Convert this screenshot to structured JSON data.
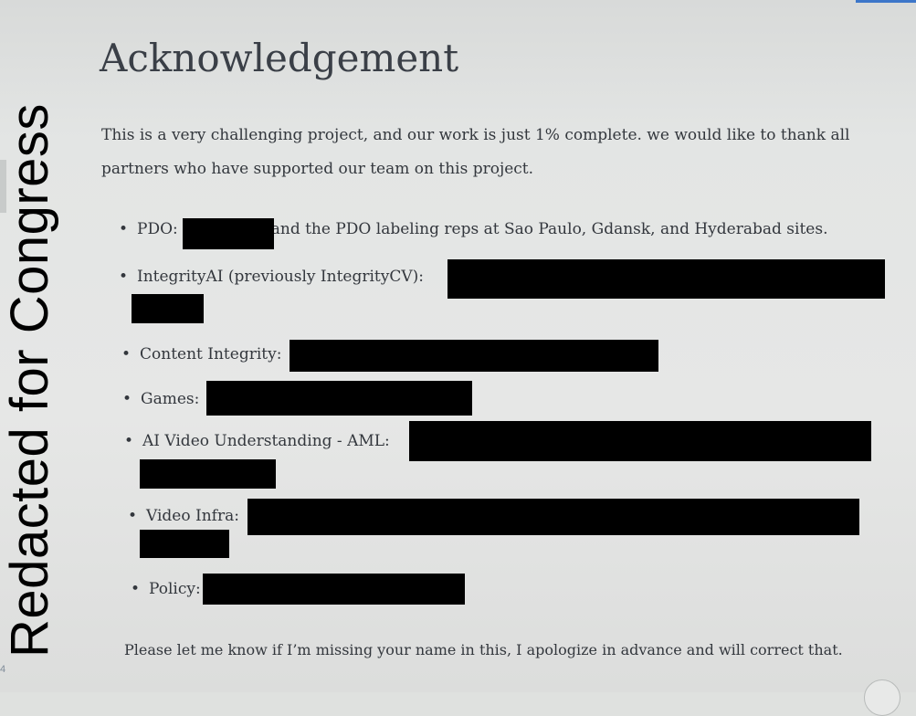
{
  "watermark": "Redacted for Congress",
  "page_number": "4",
  "title": "Acknowledgement",
  "intro": "This is a very challenging project, and our work is just 1% complete. we would like to thank all partners who have supported our team on this project.",
  "items": [
    {
      "label": "PDO:",
      "after": "and the PDO labeling reps at Sao Paulo, Gdansk, and Hyderabad sites."
    },
    {
      "label": "IntegrityAI (previously IntegrityCV):"
    },
    {
      "label": "Content Integrity:"
    },
    {
      "label": "Games:"
    },
    {
      "label": "AI Video Understanding - AML:"
    },
    {
      "label": "Video Infra:"
    },
    {
      "label": "Policy:"
    }
  ],
  "footer": "Please let me know if I’m missing your name in this, I apologize in advance and will correct that."
}
